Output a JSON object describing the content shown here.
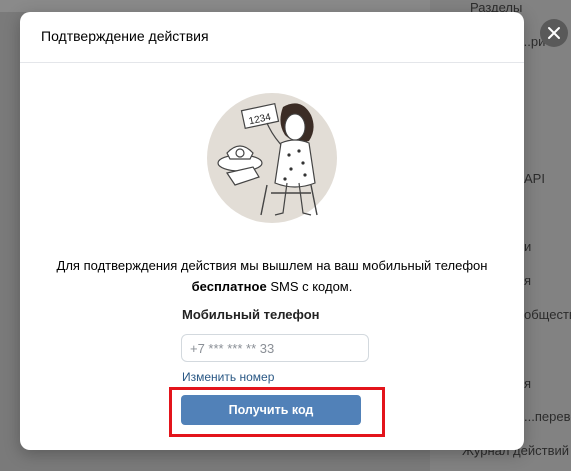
{
  "background": {
    "right_menu": [
      "Разделы",
      "...ри",
      "API",
      "и",
      "я",
      "общества",
      "я",
      "...перевод",
      "Журнал действий"
    ]
  },
  "modal": {
    "title": "Подтверждение действия",
    "illustration": {
      "sign_number": "1234"
    },
    "message_part1": "Для подтверждения действия мы вышлем на ваш мобильный телефон",
    "message_bold": "бесплатное",
    "message_part2": " SMS с кодом.",
    "phone_label": "Мобильный телефон",
    "phone_placeholder": "+7 *** *** ** 33",
    "change_number_link": "Изменить номер",
    "get_code_button": "Получить код"
  },
  "colors": {
    "button": "#5181b8",
    "link": "#2a5885",
    "highlight": "#e3141b"
  }
}
